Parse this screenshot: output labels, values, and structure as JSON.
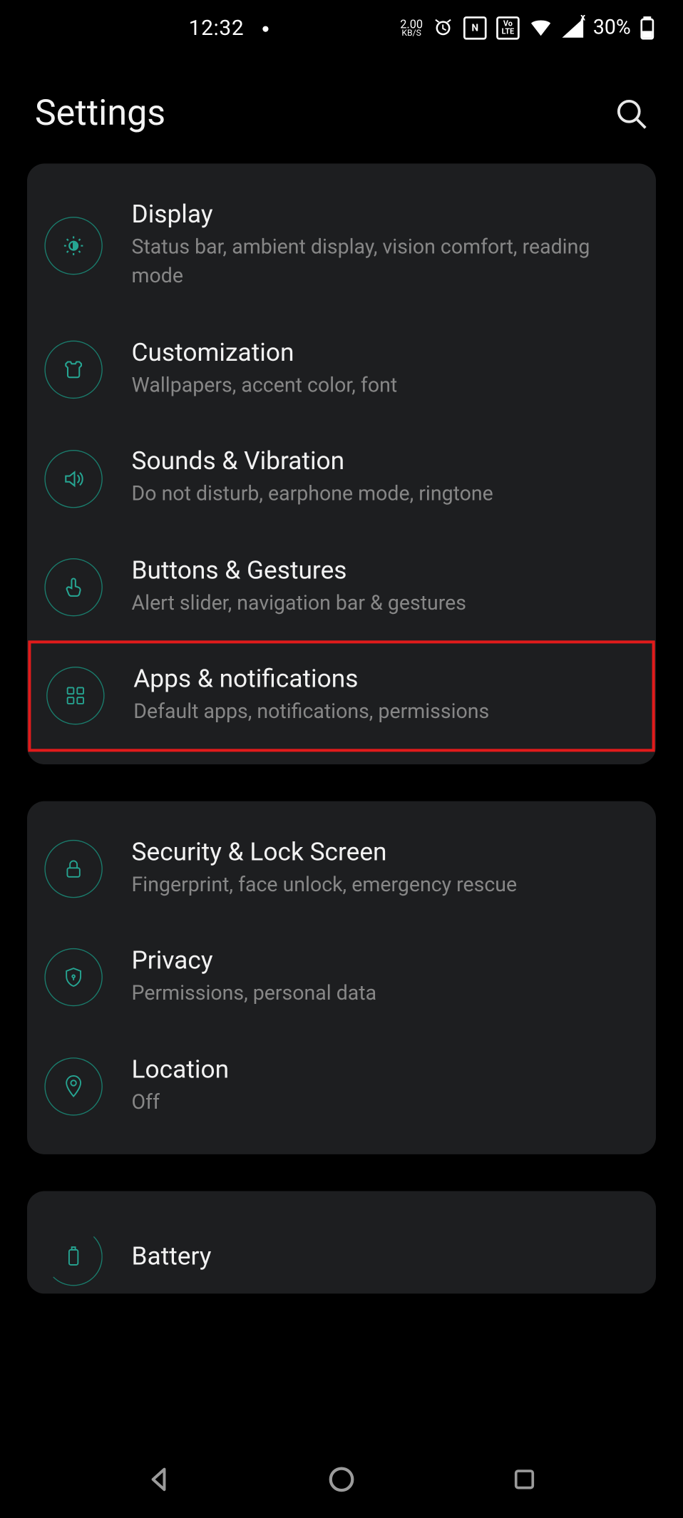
{
  "status": {
    "time": "12:32",
    "net_speed_top": "2.00",
    "net_speed_bottom": "KB/S",
    "nfc_label": "N",
    "volte_label": "Vo\nLTE",
    "battery_pct": "30%"
  },
  "header": {
    "title": "Settings"
  },
  "groups": [
    {
      "items": [
        {
          "title": "Display",
          "sub": "Status bar, ambient display, vision comfort, reading mode"
        },
        {
          "title": "Customization",
          "sub": "Wallpapers, accent color, font"
        },
        {
          "title": "Sounds & Vibration",
          "sub": "Do not disturb, earphone mode, ringtone"
        },
        {
          "title": "Buttons & Gestures",
          "sub": "Alert slider, navigation bar & gestures"
        },
        {
          "title": "Apps & notifications",
          "sub": "Default apps, notifications, permissions"
        }
      ]
    },
    {
      "items": [
        {
          "title": "Security & Lock Screen",
          "sub": "Fingerprint, face unlock, emergency rescue"
        },
        {
          "title": "Privacy",
          "sub": "Permissions, personal data"
        },
        {
          "title": "Location",
          "sub": "Off"
        }
      ]
    },
    {
      "items": [
        {
          "title": "Battery",
          "sub": ""
        }
      ]
    }
  ],
  "highlighted_item": "apps-notifications"
}
